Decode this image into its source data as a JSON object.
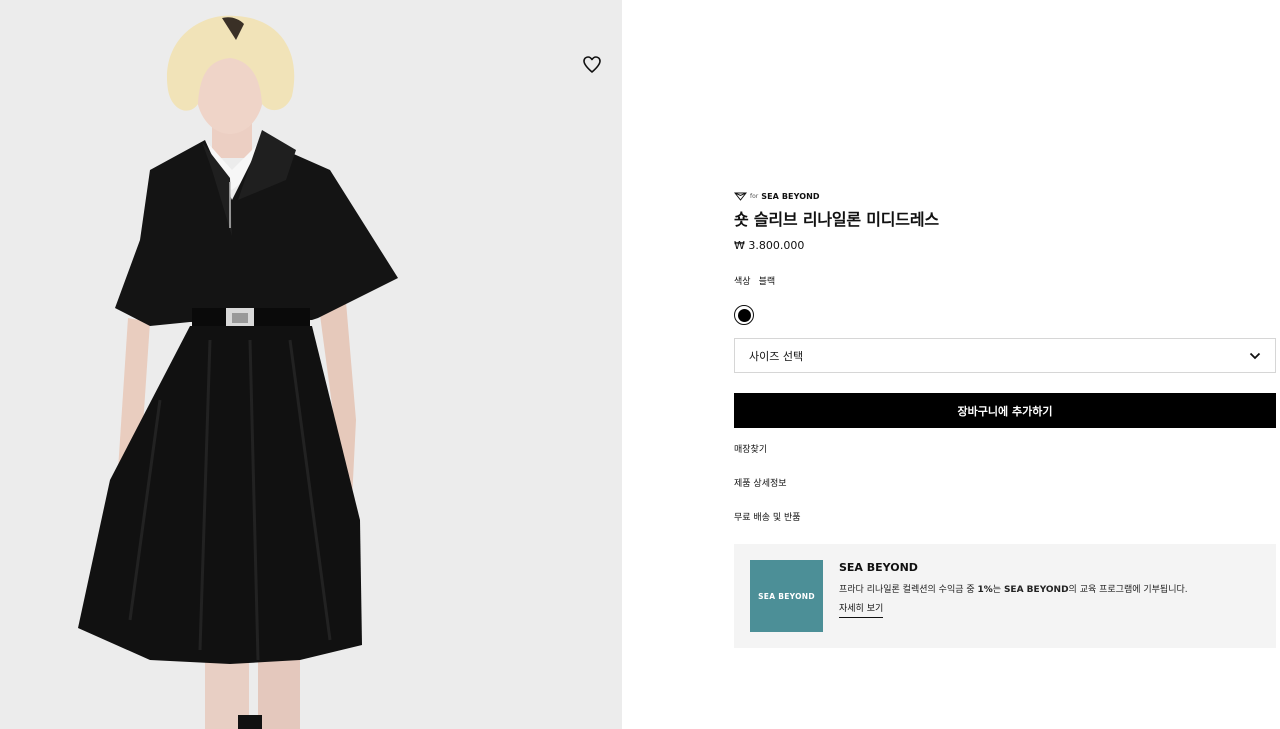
{
  "product": {
    "collab_for": "for",
    "collab_brand": "SEA BEYOND",
    "title": "숏 슬리브 리나일론 미디드레스",
    "price": "₩ 3.800.000",
    "color_label": "색상",
    "color_value": "블랙",
    "swatch_color": "#000000"
  },
  "size_select": {
    "label": "사이즈 선택",
    "icon": "chevron-down-icon"
  },
  "cart_button": {
    "label": "장바구니에 추가하기"
  },
  "links": [
    {
      "label": "매장찾기"
    },
    {
      "label": "제품 상세정보"
    },
    {
      "label": "무료 배송 및 반품"
    }
  ],
  "promo": {
    "thumb_text": "SEA BEYOND",
    "title": "SEA BEYOND",
    "desc_before": "프라다 리나일론 컬렉션의 수익금 중 ",
    "desc_pct": "1%",
    "desc_mid": "는 ",
    "desc_brand": "SEA BEYOND",
    "desc_after": "의 교육 프로그램에 기부됩니다.",
    "link": "자세히 보기",
    "thumb_color": "#4c8f97"
  },
  "icons": {
    "wishlist": "heart-icon",
    "collab": "diamond-icon"
  }
}
